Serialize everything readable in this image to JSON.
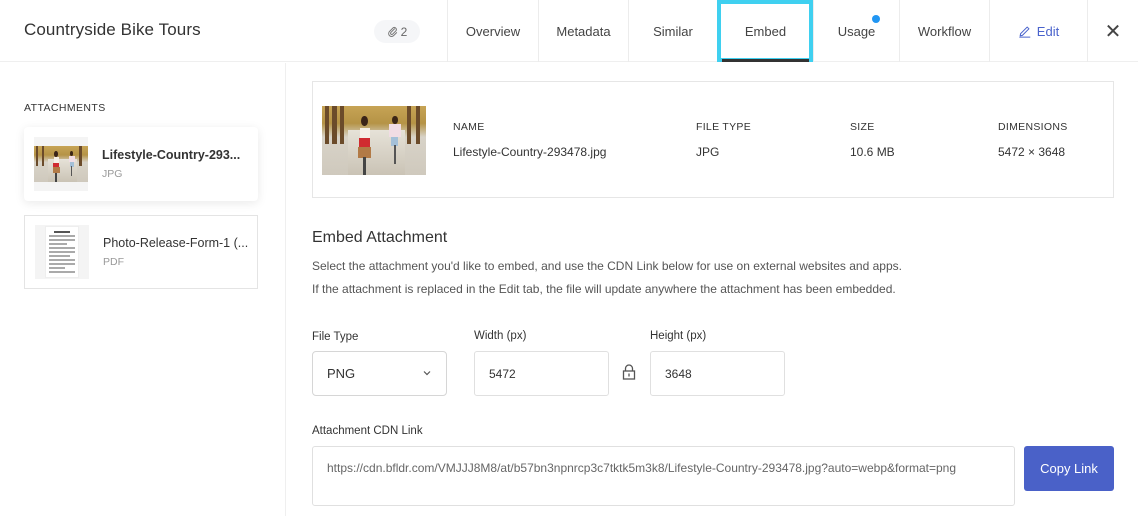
{
  "header": {
    "title": "Countryside Bike Tours",
    "attachment_count": "2",
    "attachment_icon": "paperclip-icon",
    "tabs": [
      {
        "label": "Overview",
        "active": false
      },
      {
        "label": "Metadata",
        "active": false
      },
      {
        "label": "Similar",
        "active": false
      },
      {
        "label": "Embed",
        "active": true
      },
      {
        "label": "Usage",
        "active": false,
        "notification_dot": true
      },
      {
        "label": "Workflow",
        "active": false
      }
    ],
    "edit_label": "Edit",
    "close_icon": "close-icon",
    "colors": {
      "active_outline": "#3fd0f0",
      "notification": "#2196f3",
      "edit_link": "#4a63cc"
    }
  },
  "sidebar": {
    "heading": "ATTACHMENTS",
    "attachments": [
      {
        "name": "Lifestyle-Country-293...",
        "type": "JPG",
        "selected": true
      },
      {
        "name": "Photo-Release-Form-1 (...",
        "type": "PDF",
        "selected": false
      }
    ]
  },
  "details": {
    "name_label": "NAME",
    "name_value": "Lifestyle-Country-293478.jpg",
    "filetype_label": "FILE TYPE",
    "filetype_value": "JPG",
    "size_label": "SIZE",
    "size_value": "10.6 MB",
    "dimensions_label": "DIMENSIONS",
    "dimensions_value": "5472 × 3648"
  },
  "embed": {
    "heading": "Embed Attachment",
    "description_1": "Select the attachment you'd like to embed, and use the CDN Link below for use on external websites and apps.",
    "description_2": "If the attachment is replaced in the Edit tab, the file will update anywhere the attachment has been embedded.",
    "file_type_label": "File Type",
    "file_type_value": "PNG",
    "width_label": "Width (px)",
    "width_value": "5472",
    "height_label": "Height (px)",
    "height_value": "3648",
    "lock_icon": "lock-icon",
    "cdn_label": "Attachment CDN Link",
    "cdn_value": "https://cdn.bfldr.com/VMJJJ8M8/at/b57bn3npnrcp3c7tktk5m3k8/Lifestyle-Country-293478.jpg?auto=webp&format=png",
    "copy_label": "Copy Link",
    "copy_color": "#4a61c8"
  }
}
